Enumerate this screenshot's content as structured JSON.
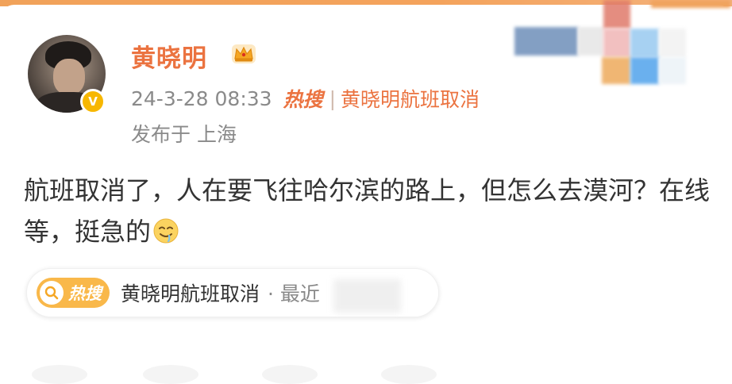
{
  "post": {
    "username": "黄晓明",
    "timestamp": "24-3-28 08:33",
    "hot_tag": "热搜",
    "separator": "|",
    "hot_topic": "黄晓明航班取消",
    "location": "发布于 上海",
    "text": "航班取消了，人在要飞往哈尔滨的路上，但怎么去漠河？在线等，挺急的"
  },
  "hot_search_pill": {
    "hot_label": "热搜",
    "topic": "黄晓明航班取消",
    "suffix": "· 最近"
  },
  "icons": {
    "verified": "verified-v-icon",
    "vip": "crown-icon",
    "emoji": "drooling-emoji-icon",
    "search": "search-icon"
  },
  "colors": {
    "accent": "#eb7340",
    "badge": "#f7b700",
    "pill_badge": "#f9b84a",
    "text": "#333333",
    "muted": "#8a8a8a"
  }
}
